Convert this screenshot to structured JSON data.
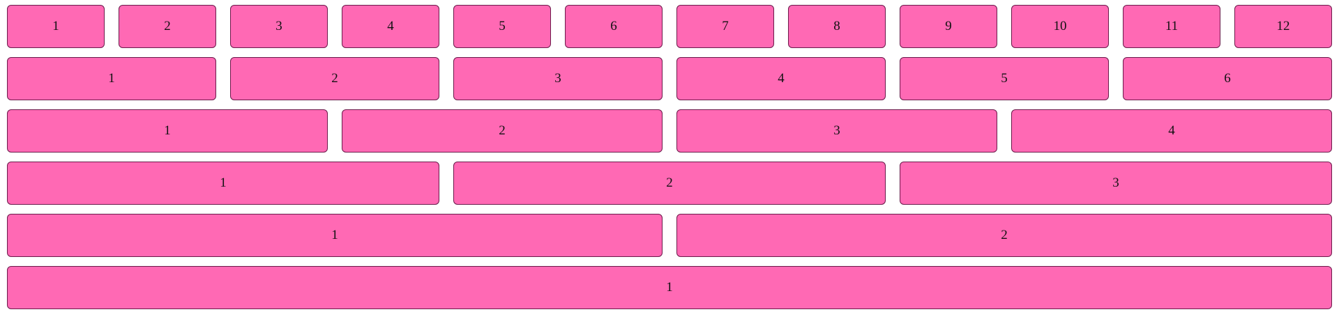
{
  "colors": {
    "cell_fill": "#ff69b4",
    "cell_border": "#6a1a4a",
    "text": "#111111",
    "background": "#ffffff"
  },
  "rows": [
    {
      "labels": [
        "1",
        "2",
        "3",
        "4",
        "5",
        "6",
        "7",
        "8",
        "9",
        "10",
        "11",
        "12"
      ]
    },
    {
      "labels": [
        "1",
        "2",
        "3",
        "4",
        "5",
        "6"
      ]
    },
    {
      "labels": [
        "1",
        "2",
        "3",
        "4"
      ]
    },
    {
      "labels": [
        "1",
        "2",
        "3"
      ]
    },
    {
      "labels": [
        "1",
        "2"
      ]
    },
    {
      "labels": [
        "1"
      ]
    }
  ]
}
